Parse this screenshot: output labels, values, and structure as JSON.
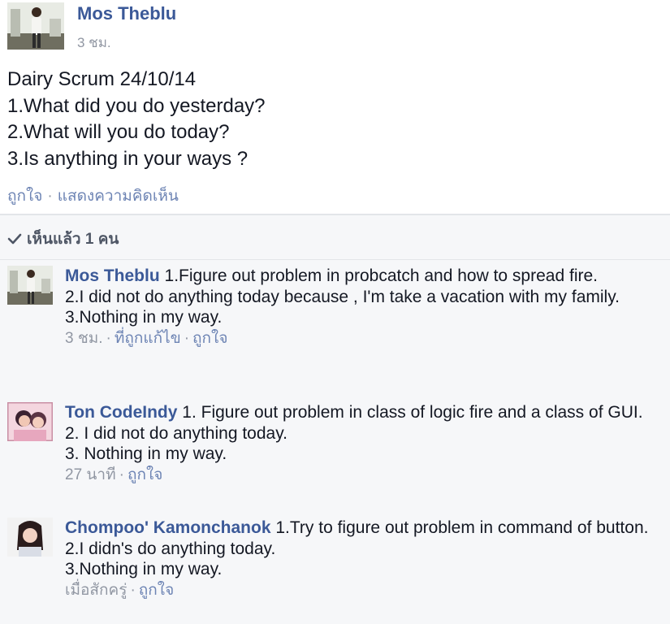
{
  "post": {
    "author": "Mos Theblu",
    "time": "3 ชม.",
    "body": [
      "Dairy Scrum 24/10/14",
      "1.What did you do yesterday?",
      "2.What will you do today?",
      "3.Is anything in your ways ?"
    ],
    "actions": {
      "like": "ถูกใจ",
      "separator": "·",
      "comment": "แสดงความคิดเห็น"
    }
  },
  "seen": {
    "label": "เห็นแล้ว 1 คน",
    "icon": "checkmark-icon"
  },
  "comments": [
    {
      "author": "Mos Theblu",
      "first": "1.Figure out problem in probcatch and how to spread fire.",
      "lines": [
        "2.I did not do anything today because , I'm take a vacation with my family.",
        "3.Nothing in my way."
      ],
      "time": "3 ชม.",
      "extra": "ที่ถูกแก้ไข",
      "like": "ถูกใจ"
    },
    {
      "author": "Ton CodeIndy",
      "first": "1. Figure out problem in class of logic fire and a class of GUI.",
      "lines": [
        "2. I did not do anything today.",
        "3. Nothing in my way."
      ],
      "time": "27 นาที",
      "like": "ถูกใจ"
    },
    {
      "author": "Chompoo' Kamonchanok",
      "first": "1.Try to figure out problem in command of button.",
      "lines": [
        "2.I didn's do anything today.",
        "3.Nothing in my way."
      ],
      "time": "เมื่อสักครู่",
      "like": "ถูกใจ"
    }
  ],
  "colors": {
    "link_blue": "#3b5998",
    "muted_link": "#6d84b4",
    "meta_gray": "#9197a3",
    "comment_bg": "#f6f7f9"
  }
}
